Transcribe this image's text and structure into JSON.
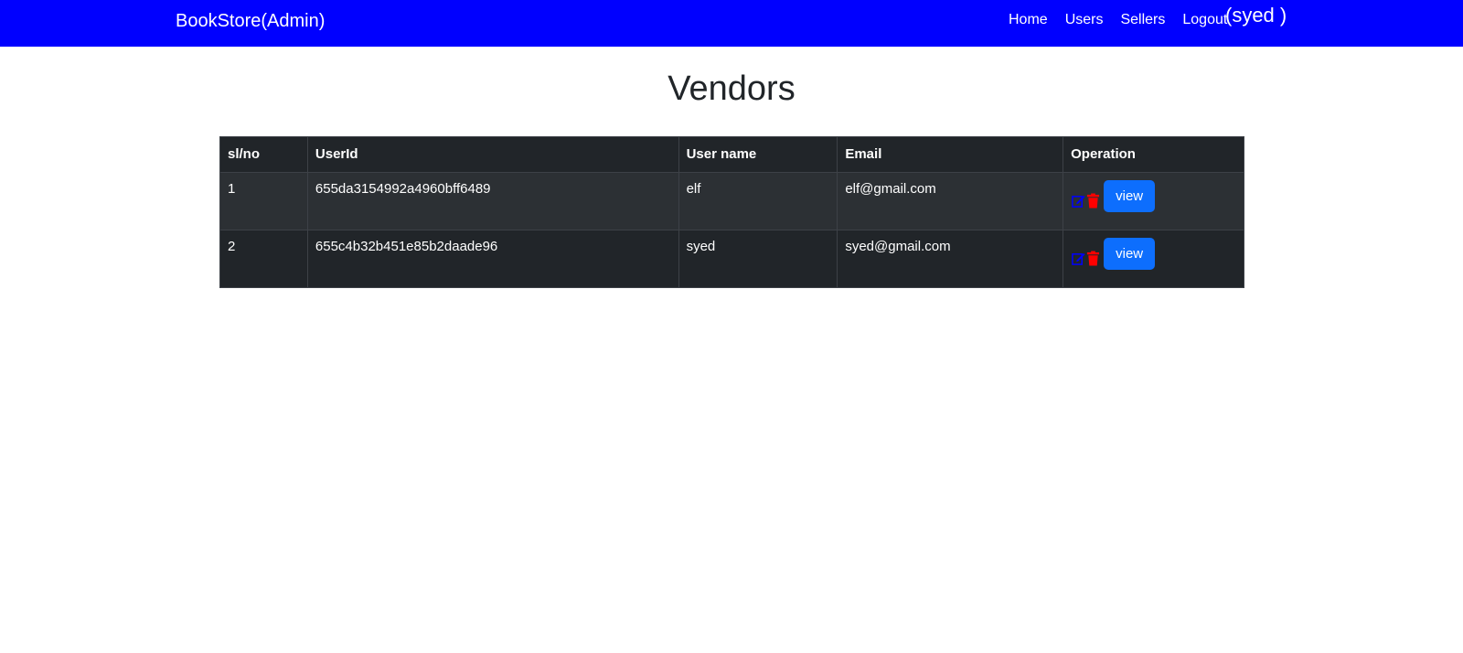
{
  "navbar": {
    "brand": "BookStore(Admin)",
    "links": [
      "Home",
      "Users",
      "Sellers",
      "Logout"
    ],
    "user": "(syed )",
    "background": "#0000ff"
  },
  "page": {
    "title": "Vendors"
  },
  "table": {
    "headers": [
      "sl/no",
      "UserId",
      "User name",
      "Email",
      "Operation"
    ],
    "rows": [
      {
        "sl": "1",
        "userId": "655da3154992a4960bff6489",
        "name": "elf",
        "email": "elf@gmail.com",
        "action": "view"
      },
      {
        "sl": "2",
        "userId": "655c4b32b451e85b2daade96",
        "name": "syed",
        "email": "syed@gmail.com",
        "action": "view"
      }
    ],
    "icons": {
      "edit": "edit-icon",
      "delete": "trash-icon"
    },
    "colors": {
      "edit": "#0000ff",
      "delete": "#ff0000",
      "view_button": "#0d6efd"
    }
  }
}
